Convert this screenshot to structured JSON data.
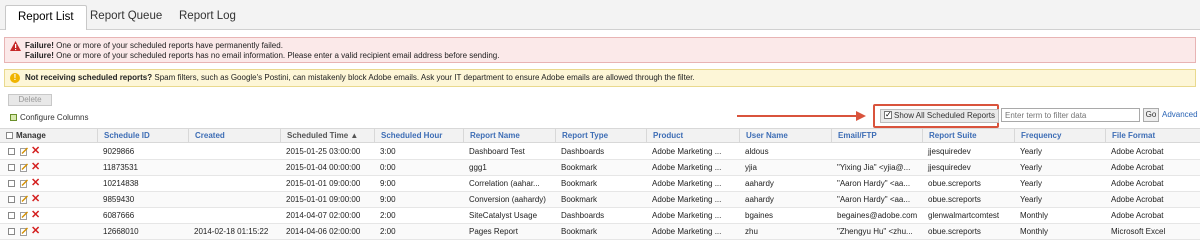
{
  "tabs": [
    {
      "label": "Report List",
      "active": true
    },
    {
      "label": "Report Queue",
      "active": false
    },
    {
      "label": "Report Log",
      "active": false
    }
  ],
  "alerts": {
    "failure_line1_title": "Failure!",
    "failure_line1_text": " One or more of your scheduled reports have permanently failed.",
    "failure_line2_title": "Failure!",
    "failure_line2_text": " One or more of your scheduled reports has no email information. Please enter a valid recipient email address before sending.",
    "warning_title": "Not receiving scheduled reports?",
    "warning_text": " Spam filters, such as Google's Postini, can mistakenly block Adobe emails. Ask your IT department to ensure Adobe emails are allowed through the filter."
  },
  "toolbar": {
    "delete_label": "Delete",
    "configure_label": "Configure Columns",
    "show_all_label": "Show All Scheduled Reports",
    "show_all_checked": true,
    "filter_placeholder": "Enter term to filter data",
    "go_label": "Go",
    "advanced_label": "Advanced"
  },
  "colors": {
    "highlight": "#d9533c",
    "link": "#3d6db5",
    "delete_icon": "#d42020"
  },
  "table": {
    "columns": [
      "Manage",
      "Schedule ID",
      "Created",
      "Scheduled Time ▲",
      "Scheduled Hour",
      "Report Name",
      "Report Type",
      "Product",
      "User Name",
      "Email/FTP",
      "Report Suite",
      "Frequency",
      "File Format"
    ],
    "rows": [
      [
        "9029866",
        "",
        "2015-01-25 03:00:00",
        "3:00",
        "Dashboard Test",
        "Dashboards",
        "Adobe Marketing ...",
        "aldous",
        "",
        "jjesquiredev",
        "Yearly",
        "Adobe Acrobat"
      ],
      [
        "11873531",
        "",
        "2015-01-04 00:00:00",
        "0:00",
        "ggg1",
        "Bookmark",
        "Adobe Marketing ...",
        "yjia",
        "\"Yixing Jia\" <yjia@...",
        "jjesquiredev",
        "Yearly",
        "Adobe Acrobat"
      ],
      [
        "10214838",
        "",
        "2015-01-01 09:00:00",
        "9:00",
        "Correlation (aahar...",
        "Bookmark",
        "Adobe Marketing ...",
        "aahardy",
        "\"Aaron Hardy\" <aa...",
        "obue.screports",
        "Yearly",
        "Adobe Acrobat"
      ],
      [
        "9859430",
        "",
        "2015-01-01 09:00:00",
        "9:00",
        "Conversion (aahardy)",
        "Bookmark",
        "Adobe Marketing ...",
        "aahardy",
        "\"Aaron Hardy\" <aa...",
        "obue.screports",
        "Yearly",
        "Adobe Acrobat"
      ],
      [
        "6087666",
        "",
        "2014-04-07 02:00:00",
        "2:00",
        "SiteCatalyst Usage",
        "Dashboards",
        "Adobe Marketing ...",
        "bgaines",
        "begaines@adobe.com",
        "glenwalmartcomtest",
        "Monthly",
        "Adobe Acrobat"
      ],
      [
        "12668010",
        "2014-02-18 01:15:22",
        "2014-04-06 02:00:00",
        "2:00",
        "Pages Report",
        "Bookmark",
        "Adobe Marketing ...",
        "zhu",
        "\"Zhengyu Hu\" <zhu...",
        "obue.screports",
        "Monthly",
        "Microsoft Excel"
      ]
    ]
  }
}
